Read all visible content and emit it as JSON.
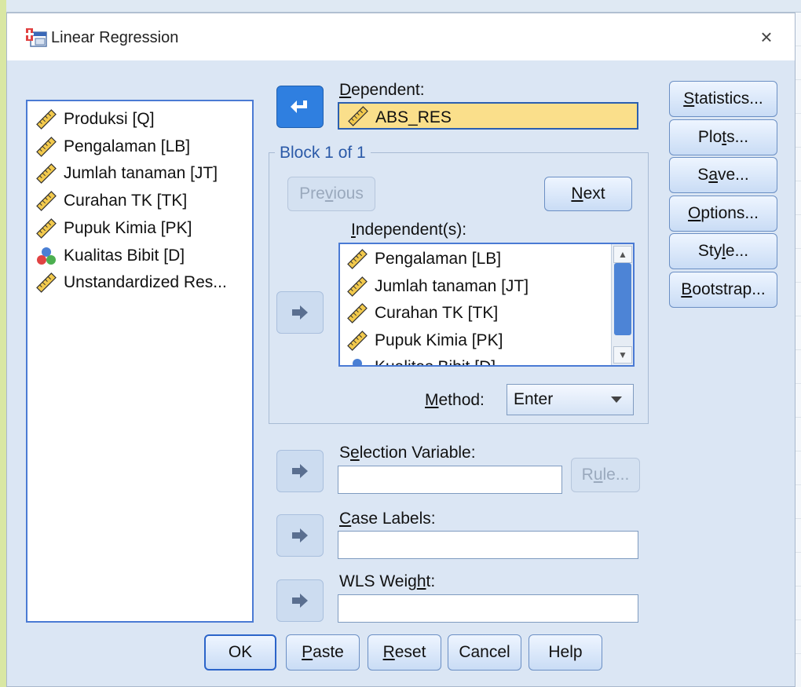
{
  "window": {
    "title": "Linear Regression",
    "close_glyph": "×"
  },
  "variable_list": {
    "items": [
      {
        "label": "Produksi [Q]",
        "icon": "scale-ruler-icon"
      },
      {
        "label": "Pengalaman [LB]",
        "icon": "scale-ruler-icon"
      },
      {
        "label": "Jumlah tanaman [JT]",
        "icon": "scale-ruler-icon"
      },
      {
        "label": "Curahan TK [TK]",
        "icon": "scale-ruler-icon"
      },
      {
        "label": "Pupuk Kimia [PK]",
        "icon": "scale-ruler-icon"
      },
      {
        "label": "Kualitas Bibit [D]",
        "icon": "nominal-balls-icon"
      },
      {
        "label": "Unstandardized Res...",
        "icon": "scale-ruler-icon"
      }
    ]
  },
  "dependent": {
    "label_pre": "",
    "label_u": "D",
    "label_post": "ependent:",
    "value": "ABS_RES"
  },
  "block": {
    "legend": "Block 1 of 1",
    "previous": {
      "pre": "Pre",
      "u": "v",
      "post": "ious"
    },
    "next": {
      "pre": "",
      "u": "N",
      "post": "ext"
    },
    "independents_label": {
      "pre": "",
      "u": "I",
      "post": "ndependent(s):"
    },
    "independents": [
      {
        "label": "Pengalaman [LB]",
        "icon": "scale-ruler-icon"
      },
      {
        "label": "Jumlah tanaman [JT]",
        "icon": "scale-ruler-icon"
      },
      {
        "label": "Curahan TK [TK]",
        "icon": "scale-ruler-icon"
      },
      {
        "label": "Pupuk Kimia [PK]",
        "icon": "scale-ruler-icon"
      },
      {
        "label": "Kualitas Bibit [D]",
        "icon": "nominal-balls-icon"
      }
    ],
    "method_label": {
      "pre": "",
      "u": "M",
      "post": "ethod:"
    },
    "method_value": "Enter"
  },
  "selection_variable": {
    "pre": "S",
    "u": "e",
    "post": "lection Variable:",
    "value": ""
  },
  "rule_button": {
    "pre": "R",
    "u": "u",
    "post": "le..."
  },
  "case_labels": {
    "pre": "",
    "u": "C",
    "post": "ase Labels:",
    "value": ""
  },
  "wls_weight": {
    "pre": "WLS Weig",
    "u": "h",
    "post": "t:",
    "value": ""
  },
  "side_buttons": [
    {
      "pre": "",
      "u": "S",
      "post": "tatistics..."
    },
    {
      "pre": "Plo",
      "u": "t",
      "post": "s..."
    },
    {
      "pre": "S",
      "u": "a",
      "post": "ve..."
    },
    {
      "pre": "",
      "u": "O",
      "post": "ptions..."
    },
    {
      "pre": "Sty",
      "u": "l",
      "post": "e..."
    },
    {
      "pre": "",
      "u": "B",
      "post": "ootstrap..."
    }
  ],
  "footer": {
    "ok": "OK",
    "paste": {
      "pre": "",
      "u": "P",
      "post": "aste"
    },
    "reset": {
      "pre": "",
      "u": "R",
      "post": "eset"
    },
    "cancel": "Cancel",
    "help": "Help"
  },
  "colors": {
    "accent": "#2f7fe0",
    "selected_field": "#fadf8b",
    "dialog_bg": "#dbe6f4"
  }
}
